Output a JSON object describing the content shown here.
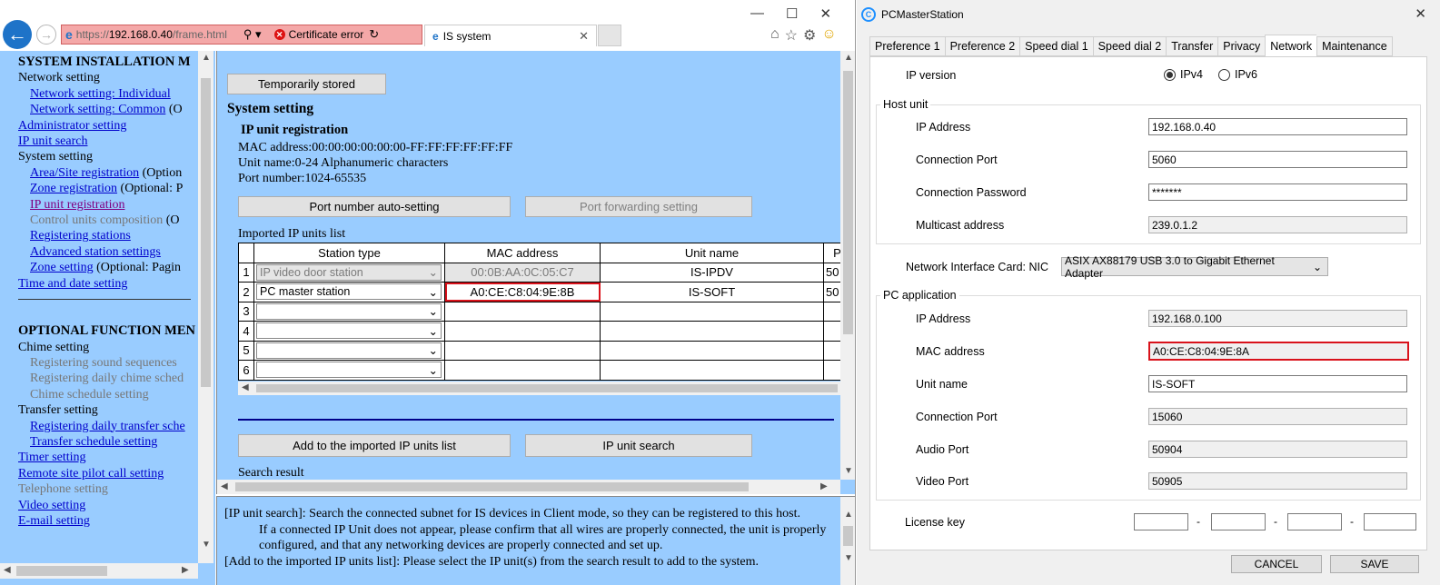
{
  "browser": {
    "url_prefix": "https://",
    "url_host": "192.168.0.40",
    "url_path": "/frame.html",
    "cert_error": "Certificate error",
    "tab_title": "IS system"
  },
  "left_menu": {
    "section1_title": "SYSTEM INSTALLATION M",
    "network_setting": "Network setting",
    "net_individual": "Network setting: Individual",
    "net_common": "Network setting: Common",
    "net_common_suffix": "(O",
    "administrator": "Administrator setting",
    "ip_unit_search": "IP unit search",
    "system_setting": "System setting",
    "area_site": "Area/Site registration",
    "area_site_suffix": "(Option",
    "zone_registration": "Zone registration",
    "zone_registration_suffix": "(Optional: P",
    "ip_unit_registration": "IP unit registration",
    "control_units": "Control units composition",
    "control_units_suffix": "(O",
    "registering_stations": "Registering stations",
    "advanced_station": "Advanced station settings",
    "zone_setting": "Zone setting",
    "zone_setting_suffix": "(Optional: Pagin",
    "time_date": "Time and date setting",
    "section2_title": "OPTIONAL FUNCTION MEN",
    "chime_setting": "Chime setting",
    "reg_sound": "Registering sound sequences",
    "reg_daily_chime": "Registering daily chime sched",
    "chime_schedule": "Chime schedule setting",
    "transfer_setting": "Transfer setting",
    "reg_daily_transfer": "Registering daily transfer sche",
    "transfer_schedule": "Transfer schedule setting",
    "timer_setting": "Timer setting",
    "remote_site": "Remote site pilot call setting",
    "telephone_setting": "Telephone setting",
    "video_setting": "Video setting",
    "email_setting": "E-mail setting"
  },
  "main": {
    "temp_stored_btn": "Temporarily stored",
    "heading": "System setting",
    "subheading": "IP unit registration",
    "mac_info": "MAC address:00:00:00:00:00:00-FF:FF:FF:FF:FF:FF",
    "unit_name_info": "Unit name:0-24 Alphanumeric characters",
    "port_info": "Port number:1024-65535",
    "port_auto_btn": "Port number auto-setting",
    "port_fwd_btn": "Port forwarding setting",
    "imported_list_label": "Imported IP units list",
    "table_headers": [
      "Station type",
      "MAC address",
      "Unit name",
      "P"
    ],
    "rows": [
      {
        "num": "1",
        "station_type": "IP video door station",
        "mac": "00:0B:AA:0C:05:C7",
        "unit_name": "IS-IPDV",
        "port": "50"
      },
      {
        "num": "2",
        "station_type": "PC master station",
        "mac": "A0:CE:C8:04:9E:8B",
        "unit_name": "IS-SOFT",
        "port": "50"
      },
      {
        "num": "3",
        "station_type": "",
        "mac": "",
        "unit_name": "",
        "port": ""
      },
      {
        "num": "4",
        "station_type": "",
        "mac": "",
        "unit_name": "",
        "port": ""
      },
      {
        "num": "5",
        "station_type": "",
        "mac": "",
        "unit_name": "",
        "port": ""
      },
      {
        "num": "6",
        "station_type": "",
        "mac": "",
        "unit_name": "",
        "port": ""
      }
    ],
    "add_imported_btn": "Add to the imported IP units list",
    "ip_search_btn": "IP unit search",
    "search_result_label": "Search result"
  },
  "help": {
    "line1": "[IP unit search]: Search the connected subnet for IS devices in Client mode, so they can be registered to this host.",
    "line2": "If a connected IP Unit does not appear, please confirm that all wires are properly connected, the unit is properly configured, and that any networking devices are properly connected and set up.",
    "line3": "[Add to the imported IP units list]: Please select the IP unit(s) from the search result to add to the system."
  },
  "pcms": {
    "title": "PCMasterStation",
    "tabs": [
      "Preference 1",
      "Preference 2",
      "Speed dial 1",
      "Speed dial 2",
      "Transfer",
      "Privacy",
      "Network",
      "Maintenance"
    ],
    "ip_version_label": "IP version",
    "ipv4": "IPv4",
    "ipv6": "IPv6",
    "host_unit_title": "Host unit",
    "host_ip_label": "IP Address",
    "host_ip": "192.168.0.40",
    "host_port_label": "Connection Port",
    "host_port": "5060",
    "host_pass_label": "Connection Password",
    "host_pass": "*******",
    "multicast_label": "Multicast address",
    "multicast": "239.0.1.2",
    "nic_label": "Network Interface Card: NIC",
    "nic_value": "ASIX AX88179 USB 3.0 to Gigabit Ethernet Adapter",
    "pc_app_title": "PC application",
    "pc_ip_label": "IP Address",
    "pc_ip": "192.168.0.100",
    "pc_mac_label": "MAC address",
    "pc_mac": "A0:CE:C8:04:9E:8A",
    "pc_unit_label": "Unit name",
    "pc_unit": "IS-SOFT",
    "pc_conn_port_label": "Connection Port",
    "pc_conn_port": "15060",
    "pc_audio_label": "Audio Port",
    "pc_audio": "50904",
    "pc_video_label": "Video Port",
    "pc_video": "50905",
    "license_label": "License key",
    "cancel_btn": "CANCEL",
    "save_btn": "SAVE"
  }
}
